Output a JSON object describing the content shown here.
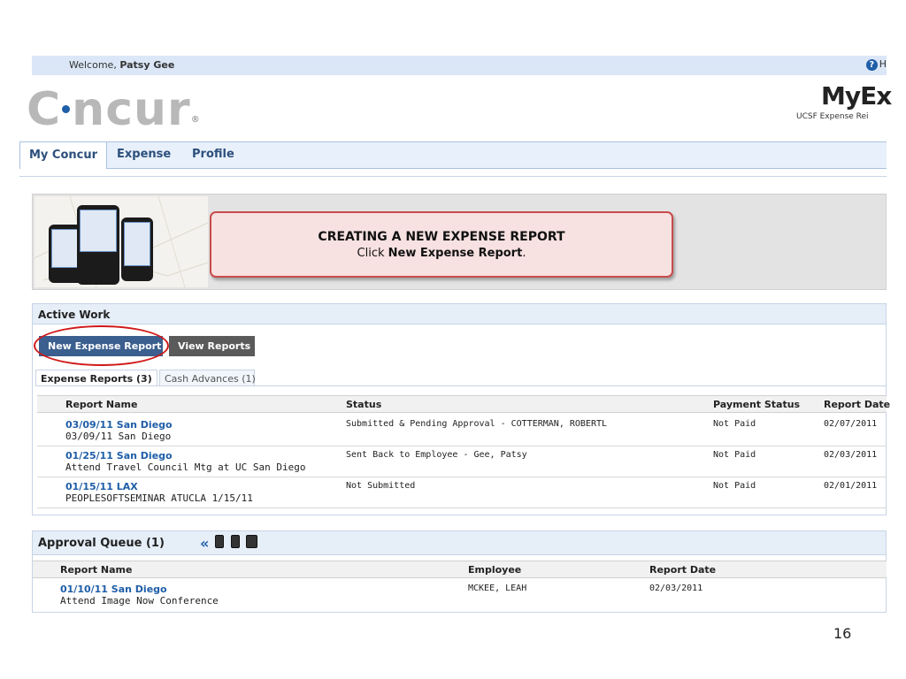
{
  "header": {
    "welcome_prefix": "Welcome,",
    "user_name": "Patsy Gee",
    "help_label": "H",
    "logo_text_c": "C",
    "logo_text_rest": "ncur",
    "logo_reg": "®",
    "product_title": "MyEx",
    "product_subtitle": "UCSF Expense Rei"
  },
  "nav": {
    "tabs": [
      {
        "label": "My Concur"
      },
      {
        "label": "Expense"
      },
      {
        "label": "Profile"
      }
    ]
  },
  "callout": {
    "title": "CREATING A NEW EXPENSE REPORT",
    "body_prefix": "Click",
    "body_bold": "New Expense Report",
    "body_suffix": "."
  },
  "active_work": {
    "title": "Active Work",
    "new_button": "New Expense Report",
    "view_button": "View Reports",
    "subtabs": [
      "Expense Reports (3)",
      "Cash Advances (1)"
    ],
    "columns": [
      "Report Name",
      "Status",
      "Payment Status",
      "Report Date"
    ],
    "rows": [
      {
        "name": "03/09/11 San Diego",
        "desc": "03/09/11 San Diego",
        "status": "Submitted & Pending Approval - COTTERMAN, ROBERTL",
        "payment": "Not Paid",
        "date": "02/07/2011"
      },
      {
        "name": "01/25/11 San Diego",
        "desc": "Attend Travel Council Mtg at UC San Diego",
        "status": "Sent Back to Employee - Gee, Patsy",
        "payment": "Not Paid",
        "date": "02/03/2011"
      },
      {
        "name": "01/15/11 LAX",
        "desc": "PEOPLESOFTSEMINAR ATUCLA 1/15/11",
        "status": "Not Submitted",
        "payment": "Not Paid",
        "date": "02/01/2011"
      }
    ]
  },
  "approval_queue": {
    "title": "Approval Queue (1)",
    "collapse_glyph": "«",
    "columns": [
      "Report Name",
      "Employee",
      "Report Date"
    ],
    "rows": [
      {
        "name": "01/10/11 San Diego",
        "desc": "Attend Image Now Conference",
        "employee": "MCKEE, LEAH",
        "date": "02/03/2011"
      }
    ]
  },
  "slide": {
    "page_number": "16"
  },
  "colors": {
    "accent": "#1f5ea8",
    "highlight": "#d01818",
    "callout_bg": "#f7e1e1"
  }
}
